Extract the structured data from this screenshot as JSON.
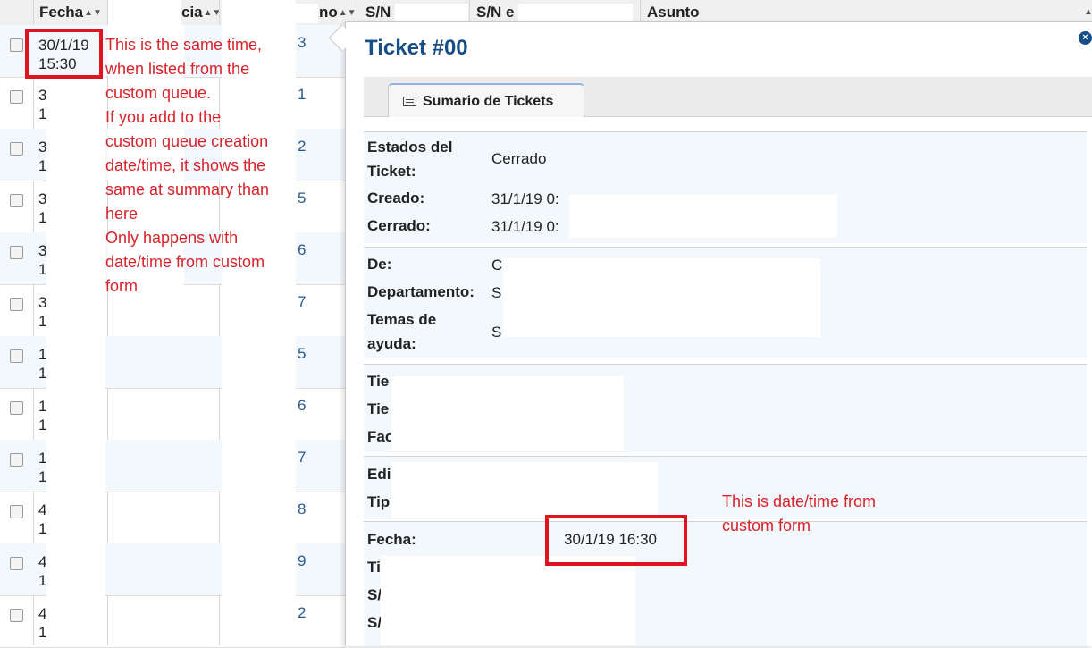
{
  "table": {
    "headers": {
      "fecha": "Fecha",
      "col2_partial": "cia",
      "col3_partial": "no",
      "sn1_partial": "S/N",
      "sn2_partial": "S/N e",
      "asunto": "Asunto"
    },
    "rows": [
      {
        "col_a_top": "30/1/19",
        "col_a_bottom": "15:30",
        "num": "3"
      },
      {
        "col_a_top": "3",
        "col_a_bottom": "1",
        "num": "1"
      },
      {
        "col_a_top": "3",
        "col_a_bottom": "1",
        "num": "2"
      },
      {
        "col_a_top": "3",
        "col_a_bottom": "1",
        "num": "5"
      },
      {
        "col_a_top": "3",
        "col_a_bottom": "1",
        "num": "6"
      },
      {
        "col_a_top": "3",
        "col_a_bottom": "1",
        "num": "7"
      },
      {
        "col_a_top": "1",
        "col_a_bottom": "1",
        "num": "5"
      },
      {
        "col_a_top": "1",
        "col_a_bottom": "1",
        "num": "6"
      },
      {
        "col_a_top": "1",
        "col_a_bottom": "1",
        "num": "7"
      },
      {
        "col_a_top": "4",
        "col_a_bottom": "1",
        "num": "8"
      },
      {
        "col_a_top": "4",
        "col_a_bottom": "1",
        "num": "9"
      },
      {
        "col_a_top": "4",
        "col_a_bottom": "1",
        "num": "2"
      }
    ]
  },
  "annotations": {
    "left_note": [
      "This is the same time,",
      "when listed from the",
      "custom queue.",
      "If you add to the",
      "custom queue creation",
      "date/time, it shows the",
      "same at summary than",
      "here",
      "Only happens with",
      "date/time from custom",
      "form"
    ],
    "right_note": [
      "This is date/time from",
      "custom form"
    ]
  },
  "ticket": {
    "title": "Ticket #00",
    "tab_label": "Sumario de Tickets",
    "status_label_1": "Estados del",
    "status_label_2": "Ticket:",
    "status_value": "Cerrado",
    "created_label": "Creado:",
    "created_value": "31/1/19 0:",
    "closed_label": "Cerrado:",
    "closed_value": "31/1/19 0:",
    "from_label": "De:",
    "from_value": "C",
    "dept_label": "Departamento:",
    "dept_value": "S",
    "topic_label_1": "Temas de",
    "topic_label_2": "ayuda:",
    "topic_value": "S",
    "partial_1": "Tie",
    "partial_2": "Tie",
    "partial_3": "Fac",
    "partial_4": "Edi",
    "partial_5": "Tip",
    "fecha_label": "Fecha:",
    "fecha_value": "30/1/19 16:30",
    "partial_6": "Ti",
    "partial_7": "S/",
    "partial_8": "S/"
  },
  "colors": {
    "annotation_red": "#e0141e",
    "title_blue": "#184e87",
    "alt_row": "#f3f8fd"
  }
}
